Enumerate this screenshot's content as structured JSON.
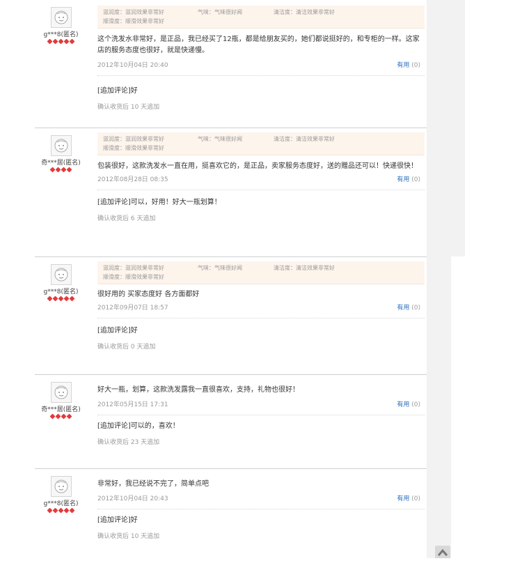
{
  "reviews": [
    {
      "user": "g***8(匿名)",
      "gems": 5,
      "props": [
        "滋润度：滋润效果非常好",
        "气味：气味很好闻",
        "清洁度：清洁效果非常好",
        "顺滑度：顺滑效果非常好"
      ],
      "text": "这个洗发水非常好，是正品，我已经买了12瓶，都是给朋友买的，她们都说挺好的，和专柜的一样。这家店的服务态度也很好，就是快递慢。",
      "time": "2012年10月04日 20:40",
      "useful_label": "有用",
      "useful_count": "(0)",
      "append_text": "[追加评论]好",
      "append_time": "确认收货后 10 天追加"
    },
    {
      "user": "奇***居(匿名)",
      "gems": 4,
      "props": [
        "滋润度：滋润效果非常好",
        "气味：气味很好闻",
        "清洁度：清洁效果非常好",
        "顺滑度：顺滑效果非常好"
      ],
      "text": "包装很好，这款洗发水一直在用，挺喜欢它的，是正品，卖家服务态度好，送的赠品还可以！快递很快！",
      "time": "2012年08月28日 08:35",
      "useful_label": "有用",
      "useful_count": "(0)",
      "append_text": "[追加评论]可以，好用！好大一瓶划算！",
      "append_time": "确认收货后 6 天追加"
    },
    {
      "user": "g***8(匿名)",
      "gems": 5,
      "props": [
        "滋润度：滋润效果非常好",
        "气味：气味很好闻",
        "清洁度：清洁效果非常好",
        "顺滑度：顺滑效果非常好"
      ],
      "text": "很好用的 买家态度好 各方面都好",
      "time": "2012年09月07日 18:57",
      "useful_label": "有用",
      "useful_count": "(0)",
      "append_text": "[追加评论]好",
      "append_time": "确认收货后 0 天追加"
    },
    {
      "user": "奇***居(匿名)",
      "gems": 4,
      "props": [],
      "text": "好大一瓶，划算，这款洗发露我一直很喜欢，支持，礼物也很好！",
      "time": "2012年05月15日 17:31",
      "useful_label": "有用",
      "useful_count": "(0)",
      "append_text": "[追加评论]可以的，喜欢！",
      "append_time": "确认收货后 23 天追加"
    },
    {
      "user": "g***8(匿名)",
      "gems": 5,
      "props": [],
      "text": "非常好，我已经说不完了，简单点吧",
      "time": "2012年10月04日 20:43",
      "useful_label": "有用",
      "useful_count": "(0)",
      "append_text": "[追加评论]好",
      "append_time": "确认收货后 10 天追加"
    }
  ],
  "back_to_top_icon": "chevron-up-icon"
}
